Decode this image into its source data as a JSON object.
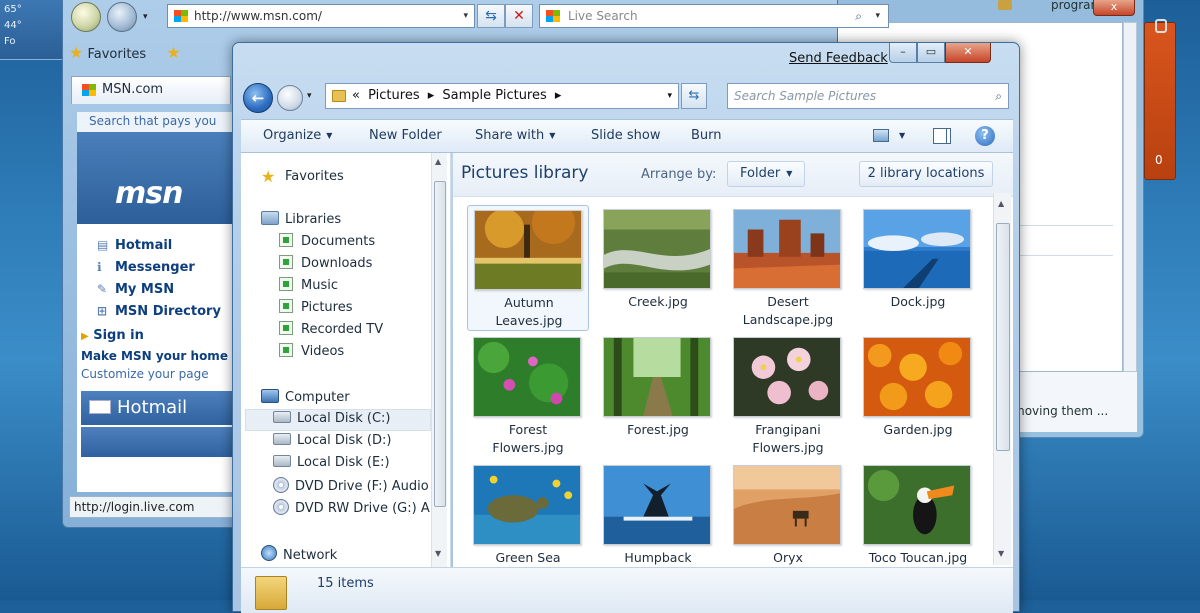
{
  "weather": {
    "temp_high": "65°",
    "temp_low": "44°",
    "footer": "Fo"
  },
  "background_window": {
    "title_fragment": "program",
    "close_label": "x",
    "bottom_text": "moving them ...",
    "gadget_count": "0"
  },
  "ie": {
    "address": "http://www.msn.com/",
    "search_placeholder": "Live Search",
    "favorites_label": "Favorites",
    "tab_label": "MSN.com",
    "page": {
      "top_link": "Search that pays you",
      "logo_text": "msn",
      "links": [
        "Hotmail",
        "Messenger",
        "My MSN",
        "MSN Directory"
      ],
      "link_icons": [
        "▤",
        "ℹ",
        "✎",
        "⊞"
      ],
      "sign_in": "Sign in",
      "make_msn": "Make MSN your home",
      "customize": "Customize your page",
      "hotmail_box": "Hotmail"
    },
    "status_url": "http://login.live.com"
  },
  "explorer": {
    "send_feedback": "Send Feedback",
    "breadcrumb": [
      "«",
      "Pictures",
      "▸",
      "Sample Pictures",
      "▸"
    ],
    "search_placeholder": "Search Sample Pictures",
    "toolbar": [
      "Organize",
      "New Folder",
      "Share with",
      "Slide show",
      "Burn"
    ],
    "nav": {
      "favorites": "Favorites",
      "libraries": "Libraries",
      "library_items": [
        "Documents",
        "Downloads",
        "Music",
        "Pictures",
        "Recorded TV",
        "Videos"
      ],
      "computer": "Computer",
      "drives": [
        "Local Disk (C:)",
        "Local Disk (D:)",
        "Local Disk (E:)",
        "DVD Drive (F:) Audio",
        "DVD RW Drive (G:) A"
      ],
      "network": "Network"
    },
    "library_title": "Pictures library",
    "arrange_by": "Arrange by:",
    "arrange_value": "Folder",
    "library_locations": "2 library locations",
    "files": [
      {
        "name": "Autumn Leaves.jpg",
        "line1": "Autumn",
        "line2": "Leaves.jpg"
      },
      {
        "name": "Creek.jpg",
        "line1": "Creek.jpg",
        "line2": ""
      },
      {
        "name": "Desert Landscape.jpg",
        "line1": "Desert",
        "line2": "Landscape.jpg"
      },
      {
        "name": "Dock.jpg",
        "line1": "Dock.jpg",
        "line2": ""
      },
      {
        "name": "Forest Flowers.jpg",
        "line1": "Forest",
        "line2": "Flowers.jpg"
      },
      {
        "name": "Forest.jpg",
        "line1": "Forest.jpg",
        "line2": ""
      },
      {
        "name": "Frangipani Flowers.jpg",
        "line1": "Frangipani",
        "line2": "Flowers.jpg"
      },
      {
        "name": "Garden.jpg",
        "line1": "Garden.jpg",
        "line2": ""
      },
      {
        "name": "Green Sea",
        "line1": "Green Sea",
        "line2": ""
      },
      {
        "name": "Humpback",
        "line1": "Humpback",
        "line2": ""
      },
      {
        "name": "Oryx",
        "line1": "Oryx",
        "line2": ""
      },
      {
        "name": "Toco Toucan.jpg",
        "line1": "Toco Toucan.jpg",
        "line2": ""
      }
    ],
    "item_count": "15 items"
  }
}
